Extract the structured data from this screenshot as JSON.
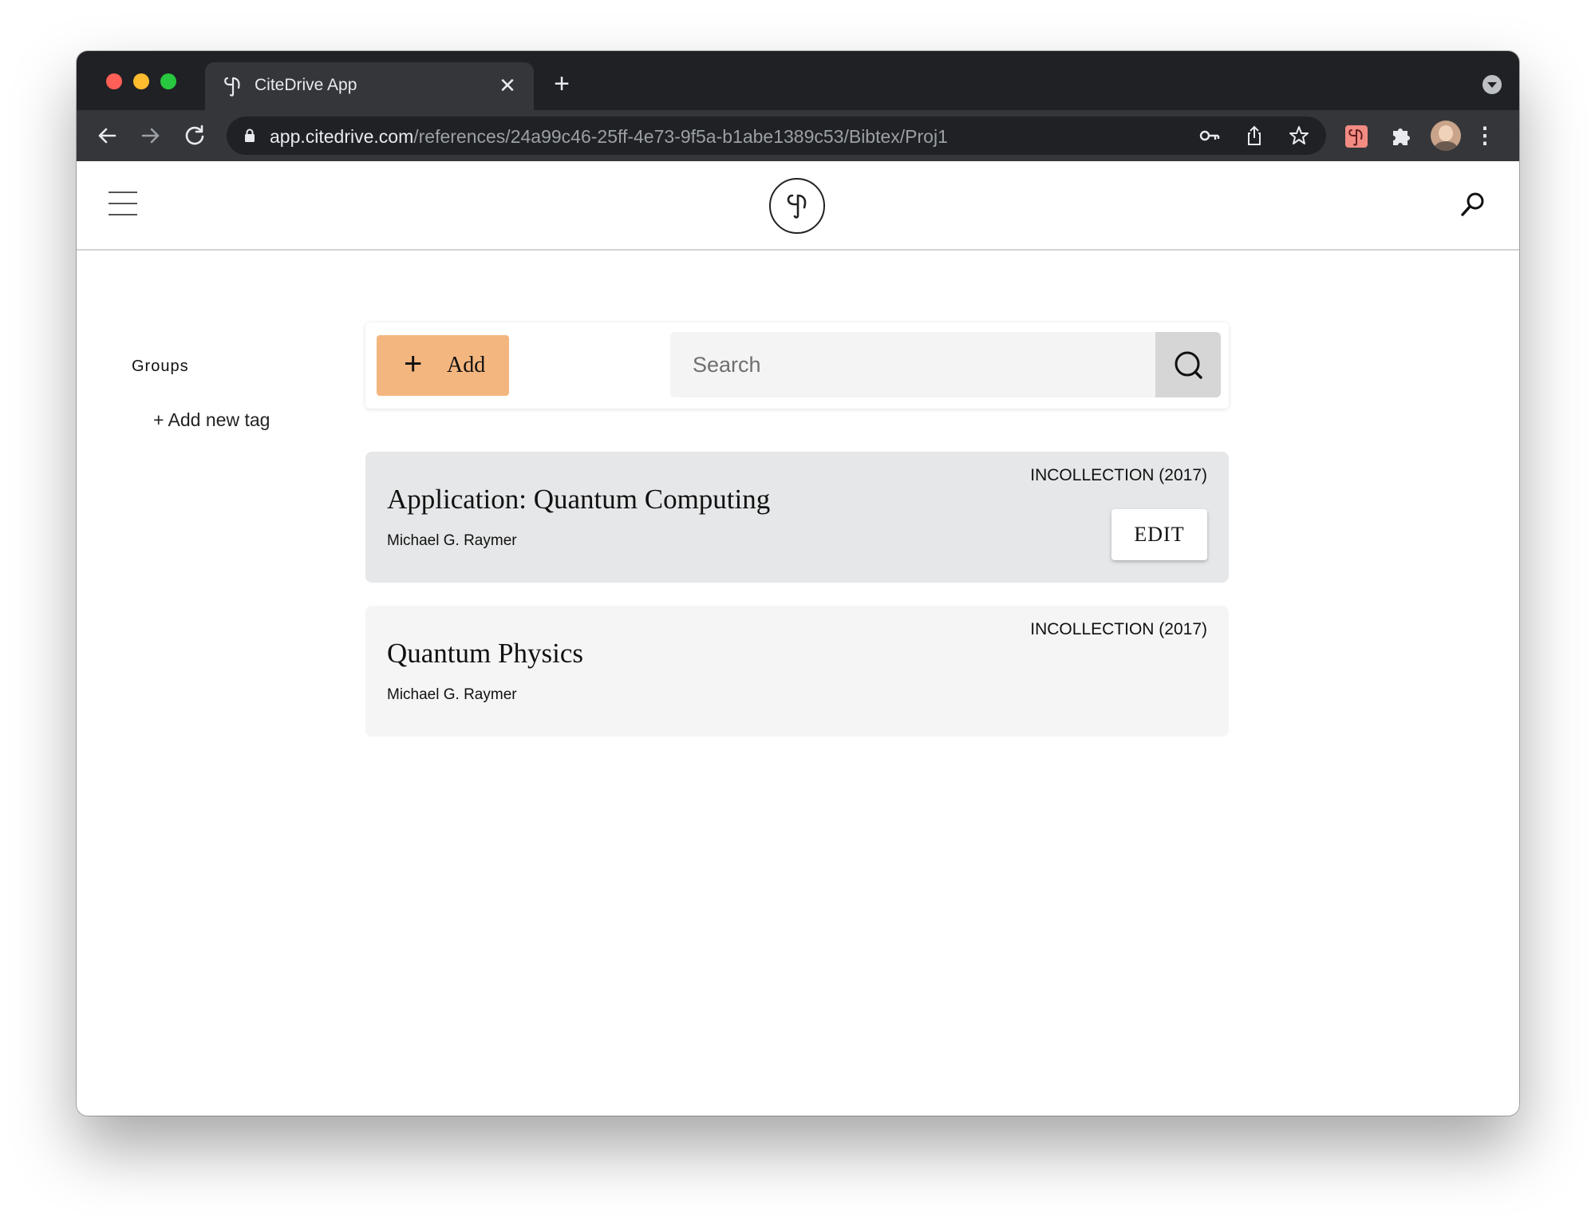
{
  "browser": {
    "tab": {
      "title": "CiteDrive App",
      "close_icon": "close-icon"
    },
    "new_tab_label": "+",
    "url": {
      "host": "app.citedrive.com",
      "path": "/references/24a99c46-25ff-4e73-9f5a-b1abe1389c53/Bibtex/Proj1"
    },
    "icons": [
      "back-arrow-icon",
      "forward-arrow-icon",
      "reload-icon",
      "lock-icon",
      "key-icon",
      "share-icon",
      "star-icon",
      "citedrive-extension-icon",
      "puzzle-icon",
      "profile-avatar",
      "kebab-menu-icon"
    ]
  },
  "app": {
    "header_icons": [
      "hamburger-menu-icon",
      "citedrive-logo",
      "search-icon"
    ]
  },
  "sidebar": {
    "title": "Groups",
    "add_tag_label": "+ Add new tag"
  },
  "toolbar": {
    "add_label": "Add",
    "search_placeholder": "Search"
  },
  "references": [
    {
      "title": "Application: Quantum Computing",
      "author": "Michael G. Raymer",
      "type": "INCOLLECTION (2017)",
      "edit_label": "EDIT",
      "highlighted": true
    },
    {
      "title": "Quantum Physics",
      "author": "Michael G. Raymer",
      "type": "INCOLLECTION (2017)"
    }
  ],
  "colors": {
    "add_button": "#f4b67f",
    "card_highlight": "#e6e7e8",
    "card_default": "#f5f5f5",
    "chrome_dark": "#202124",
    "chrome_toolbar": "#35363a"
  }
}
